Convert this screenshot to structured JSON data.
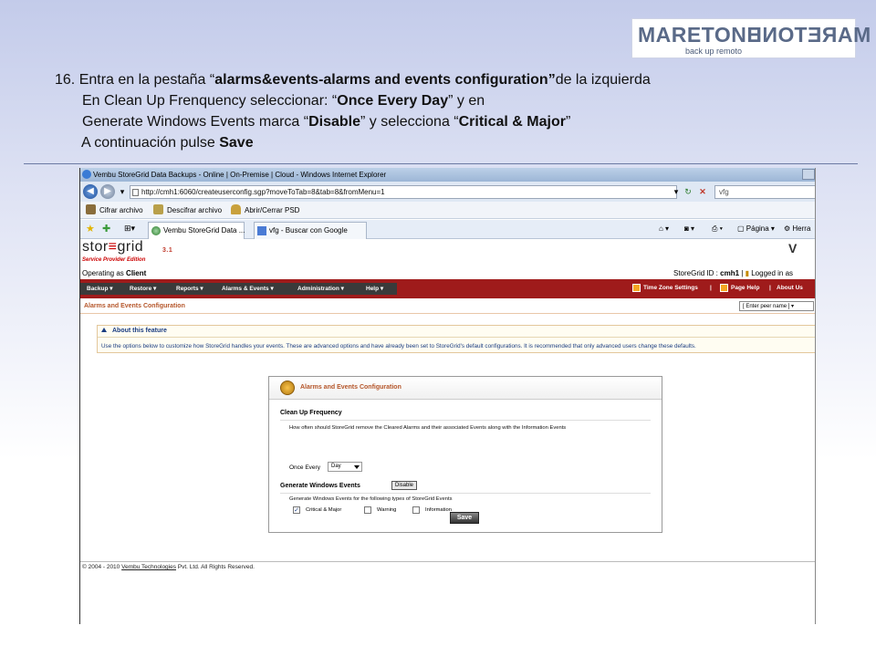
{
  "logo": {
    "front": "MARETONE",
    "mirror": "MARETONE",
    "subtitle": "back up remoto"
  },
  "instructions": {
    "line1_pre": "16. Entra en la pestaña “",
    "line1_bold": "alarms&events-alarms and events configuration”",
    "line1_post": "de la izquierda",
    "line2_pre": "En Clean Up Frenquency seleccionar: “",
    "line2_bold": "Once Every Day",
    "line2_post": "” y en",
    "line3_pre": "Generate Windows Events marca “",
    "line3_bold": "Disable",
    "line3_mid": "” y selecciona “",
    "line3_bold2": "Critical & Major",
    "line3_post": "”",
    "line4_pre": "A continuación pulse ",
    "line4_bold": "Save"
  },
  "browser": {
    "title": "Vembu StoreGrid Data Backups - Online | On-Premise | Cloud - Windows Internet Explorer",
    "url": "http://cmh1:6060/createuserconfig.sgp?moveToTab=8&tab=8&fromMenu=1",
    "search_value": "vfg",
    "commands": [
      "Cifrar archivo",
      "Descifrar archivo",
      "Abrir/Cerrar PSD"
    ],
    "tabs": [
      "Vembu StoreGrid Data ...",
      "vfg - Buscar con Google"
    ],
    "right_tools": {
      "page": "Página",
      "tools": "Herra"
    }
  },
  "app": {
    "logo_text": "stor",
    "logo_text2": "grid",
    "version": "3.1",
    "edition": "Service Provider Edition",
    "operating_label": "Operating as",
    "operating_value": "Client",
    "vendor_mark": "V",
    "storegrid_id_label": "StoreGrid ID :",
    "storegrid_id_value": "cmh1",
    "logged_in": "Logged in as",
    "menu": [
      "Backup ▾",
      "Restore ▾",
      "Reports ▾",
      "Alarms & Events ▾",
      "Administration ▾",
      "Help ▾"
    ],
    "right_menu": {
      "timezone": "Time Zone Settings",
      "page_help": "Page Help",
      "about": "About Us"
    },
    "breadcrumb": "Alarms and Events Configuration",
    "peer_placeholder": "[ Enter peer name ]",
    "about": {
      "title": "About this feature",
      "text": "Use the options below to customize how StoreGrid handles your events. These are advanced options and have already been set to StoreGrid's default configurations. It is recommended that only advanced users change these defaults."
    },
    "config": {
      "title": "Alarms and Events Configuration",
      "cleanup_title": "Clean Up Frequency",
      "cleanup_desc": "How often should StoreGrid remove the Cleared Alarms and their associated Events along with the Information Events",
      "once_every": "Once Every",
      "frequency_value": "Day",
      "win_events_title": "Generate Windows Events",
      "disable_label": "Disable",
      "win_events_desc": "Generate Windows Events for the following types of StoreGrid Events",
      "options": [
        {
          "label": "Critical & Major",
          "checked": true
        },
        {
          "label": "Warning",
          "checked": false
        },
        {
          "label": "Information",
          "checked": false
        }
      ],
      "save_label": "Save"
    },
    "footer_pre": "© 2004 - 2010 ",
    "footer_link": "Vembu Technologies",
    "footer_post": " Pvt. Ltd. All Rights Reserved."
  },
  "colors": {
    "menu_red": "#9f1b1b",
    "accent_orange": "#b5562a",
    "link_blue": "#1a3c80"
  }
}
